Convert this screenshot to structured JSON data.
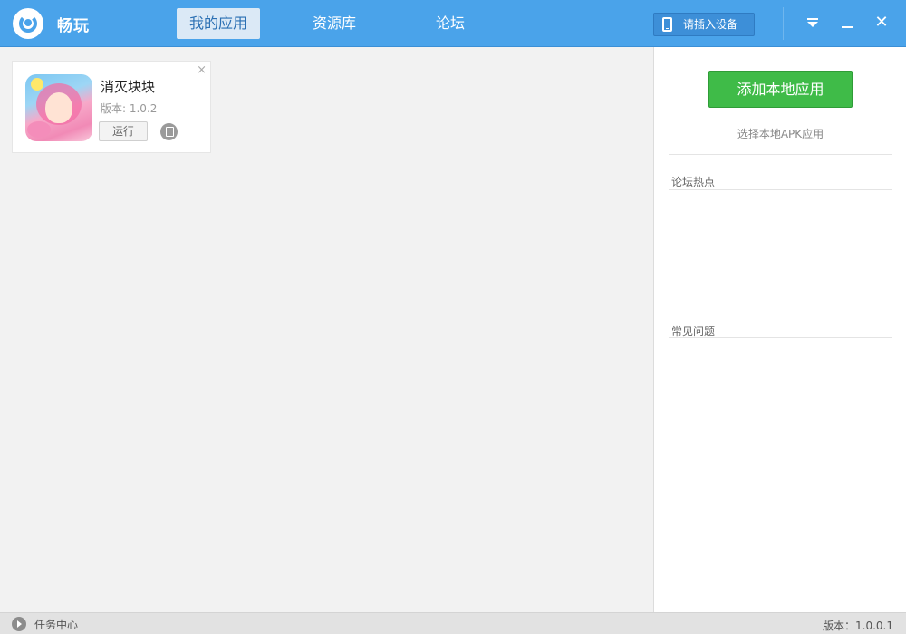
{
  "header": {
    "app_title": "畅玩",
    "tabs": [
      {
        "label": "我的应用",
        "active": true
      },
      {
        "label": "资源库",
        "active": false
      },
      {
        "label": "论坛",
        "active": false
      }
    ],
    "device_button": "请插入设备",
    "icons": {
      "logo": "logo-ring-icon",
      "device": "phone-icon",
      "menu": "dropdown-menu-icon",
      "minimize": "minimize-icon",
      "close": "close-icon"
    },
    "close_glyph": "✕",
    "color": "#4aa3ea"
  },
  "apps": [
    {
      "name": "消灭块块",
      "version": "版本: 1.0.2",
      "run_label": "运行",
      "remove_glyph": "×",
      "icon": "game-girl-icon",
      "uninstall_icon": "uninstall-icon"
    }
  ],
  "sidebar": {
    "add_button": "添加本地应用",
    "add_hint": "选择本地APK应用",
    "forum_hot": "论坛热点",
    "faq": "常见问题",
    "accent": "#3fbb48"
  },
  "statusbar": {
    "task_center": "任务中心",
    "version": "版本：1.0.0.1",
    "task_icon": "arrow-right-circle-icon"
  }
}
